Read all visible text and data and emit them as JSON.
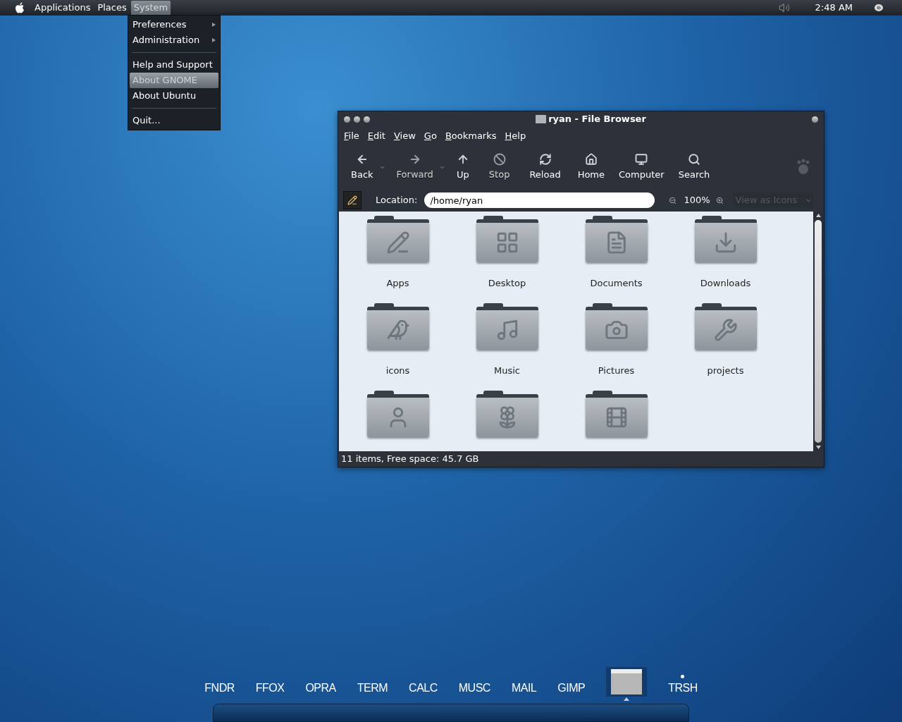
{
  "top_panel": {
    "menus": [
      {
        "label": "Applications",
        "selected": false
      },
      {
        "label": "Places",
        "selected": false
      },
      {
        "label": "System",
        "selected": true
      }
    ],
    "clock": "2:48 AM"
  },
  "system_menu": [
    {
      "kind": "item",
      "label": "Preferences",
      "submenu": true,
      "selected": false
    },
    {
      "kind": "item",
      "label": "Administration",
      "submenu": true,
      "selected": false
    },
    {
      "kind": "separator"
    },
    {
      "kind": "item",
      "label": "Help and Support",
      "submenu": false,
      "selected": false
    },
    {
      "kind": "item",
      "label": "About GNOME",
      "submenu": false,
      "selected": true
    },
    {
      "kind": "item",
      "label": "About Ubuntu",
      "submenu": false,
      "selected": false
    },
    {
      "kind": "separator"
    },
    {
      "kind": "item",
      "label": "Quit...",
      "submenu": false,
      "selected": false
    }
  ],
  "window": {
    "title": "ryan - File Browser",
    "menubar": [
      {
        "mnemonic": "F",
        "rest": "ile"
      },
      {
        "mnemonic": "E",
        "rest": "dit"
      },
      {
        "mnemonic": "V",
        "rest": "iew"
      },
      {
        "mnemonic": "G",
        "rest": "o"
      },
      {
        "mnemonic": "B",
        "rest": "ookmarks"
      },
      {
        "mnemonic": "H",
        "rest": "elp"
      }
    ],
    "toolbar": [
      {
        "label": "Back",
        "disabled": false,
        "dropdown": true
      },
      {
        "label": "Forward",
        "disabled": true,
        "dropdown": true
      },
      {
        "label": "Up",
        "disabled": false,
        "dropdown": false
      },
      {
        "label": "Stop",
        "disabled": true,
        "dropdown": false
      },
      {
        "label": "Reload",
        "disabled": false,
        "dropdown": false
      },
      {
        "label": "Home",
        "disabled": false,
        "dropdown": false
      },
      {
        "label": "Computer",
        "disabled": false,
        "dropdown": false
      },
      {
        "label": "Search",
        "disabled": false,
        "dropdown": false
      }
    ],
    "location": {
      "label": "Location:",
      "value": "/home/ryan",
      "zoom": "100%",
      "view": "View as Icons"
    },
    "files": [
      {
        "kind": "folder",
        "label": "Apps"
      },
      {
        "kind": "folder",
        "label": "Desktop"
      },
      {
        "kind": "folder",
        "label": "Documents"
      },
      {
        "kind": "folder",
        "label": "Downloads"
      },
      {
        "kind": "folder",
        "label": "icons"
      },
      {
        "kind": "folder",
        "label": "Music"
      },
      {
        "kind": "folder",
        "label": "Pictures"
      },
      {
        "kind": "folder",
        "label": "projects"
      },
      {
        "kind": "folder_cut"
      },
      {
        "kind": "folder_cut"
      },
      {
        "kind": "folder_cut"
      }
    ],
    "status_bar": "11 items, Free space: 45.7 GB"
  },
  "dock": [
    {
      "kind": "text",
      "label": "FNDR",
      "running": false
    },
    {
      "kind": "text",
      "label": "FFOX",
      "running": false
    },
    {
      "kind": "text",
      "label": "OPRA",
      "running": false
    },
    {
      "kind": "text",
      "label": "TERM",
      "running": false
    },
    {
      "kind": "text",
      "label": "CALC",
      "running": false
    },
    {
      "kind": "text",
      "label": "MUSC",
      "running": false
    },
    {
      "kind": "text",
      "label": "MAIL",
      "running": false
    },
    {
      "kind": "text",
      "label": "GIMP",
      "running": false
    },
    {
      "kind": "window",
      "running": true
    },
    {
      "kind": "text",
      "label": "TRSH",
      "running": true
    }
  ]
}
